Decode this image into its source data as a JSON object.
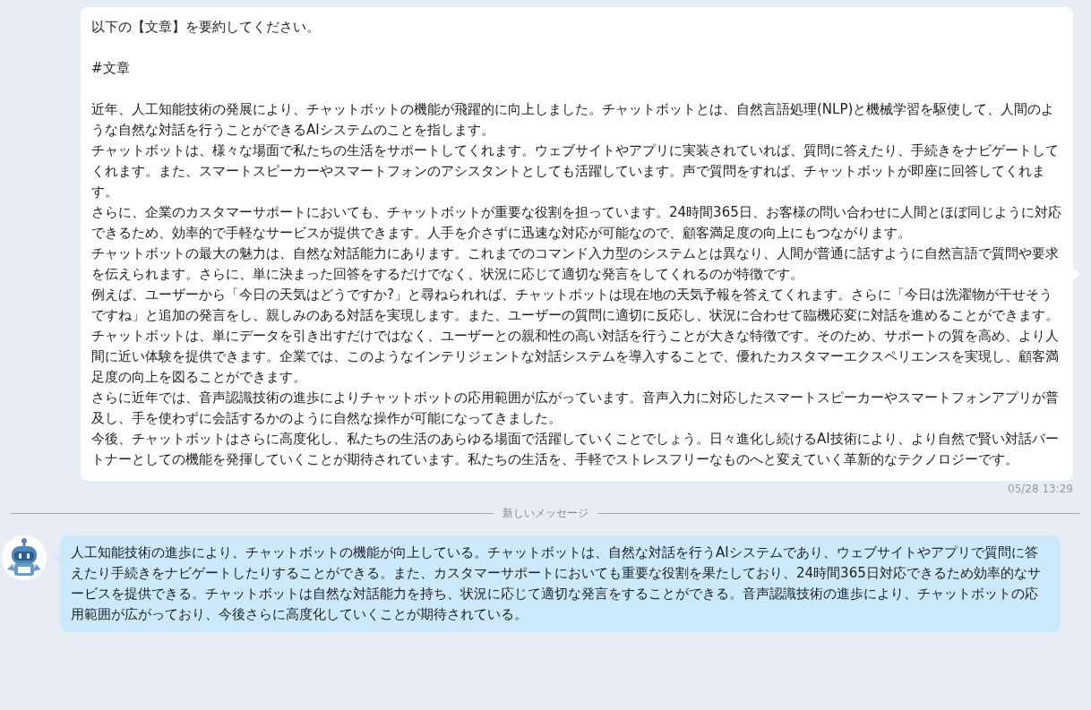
{
  "user_message": {
    "lines": [
      "以下の【文章】を要約してください。",
      "#文章"
    ],
    "paragraphs": [
      "近年、人工知能技術の発展により、チャットボットの機能が飛躍的に向上しました。チャットボットとは、自然言語処理(NLP)と機械学習を駆使して、人間のような自然な対話を行うことができるAIシステムのことを指します。",
      "チャットボットは、様々な場面で私たちの生活をサポートしてくれます。ウェブサイトやアプリに実装されていれば、質問に答えたり、手続きをナビゲートしてくれます。また、スマートスピーカーやスマートフォンのアシスタントとしても活躍しています。声で質問をすれば、チャットボットが即座に回答してくれます。",
      "さらに、企業のカスタマーサポートにおいても、チャットボットが重要な役割を担っています。24時間365日、お客様の問い合わせに人間とほぼ同じように対応できるため、効率的で手軽なサービスが提供できます。人手を介さずに迅速な対応が可能なので、顧客満足度の向上にもつながります。",
      "チャットボットの最大の魅力は、自然な対話能力にあります。これまでのコマンド入力型のシステムとは異なり、人間が普通に話すように自然言語で質問や要求を伝えられます。さらに、単に決まった回答をするだけでなく、状況に応じて適切な発言をしてくれるのが特徴です。",
      "例えば、ユーザーから「今日の天気はどうですか?」と尋ねられれば、チャットボットは現在地の天気予報を答えてくれます。さらに「今日は洗濯物が干せそうですね」と追加の発言をし、親しみのある対話を実現します。また、ユーザーの質問に適切に反応し、状況に合わせて臨機応変に対話を進めることができます。",
      "チャットボットは、単にデータを引き出すだけではなく、ユーザーとの親和性の高い対話を行うことが大きな特徴です。そのため、サポートの質を高め、より人間に近い体験を提供できます。企業では、このようなインテリジェントな対話システムを導入することで、優れたカスタマーエクスペリエンスを実現し、顧客満足度の向上を図ることができます。",
      "さらに近年では、音声認識技術の進歩によりチャットボットの応用範囲が広がっています。音声入力に対応したスマートスピーカーやスマートフォンアプリが普及し、手を使わずに会話するかのように自然な操作が可能になってきました。",
      "今後、チャットボットはさらに高度化し、私たちの生活のあらゆる場面で活躍していくことでしょう。日々進化し続けるAI技術により、より自然で賢い対話パートナーとしての機能を発揮していくことが期待されています。私たちの生活を、手軽でストレスフリーなものへと変えていく革新的なテクノロジーです。"
    ],
    "time": "05/28 13:29"
  },
  "divider": {
    "label": "新しいメッセージ"
  },
  "bot_message": {
    "text": "人工知能技術の進歩により、チャットボットの機能が向上している。チャットボットは、自然な対話を行うAIシステムであり、ウェブサイトやアプリで質問に答えたり手続きをナビゲートしたりすることができる。また、カスタマーサポートにおいても重要な役割を果たしており、24時間365日対応できるため効率的なサービスを提供できる。チャットボットは自然な対話能力を持ち、状況に応じて適切な発言をすることができる。音声認識技術の進歩により、チャットボットの応用範囲が広がっており、今後さらに高度化していくことが期待されている。"
  }
}
